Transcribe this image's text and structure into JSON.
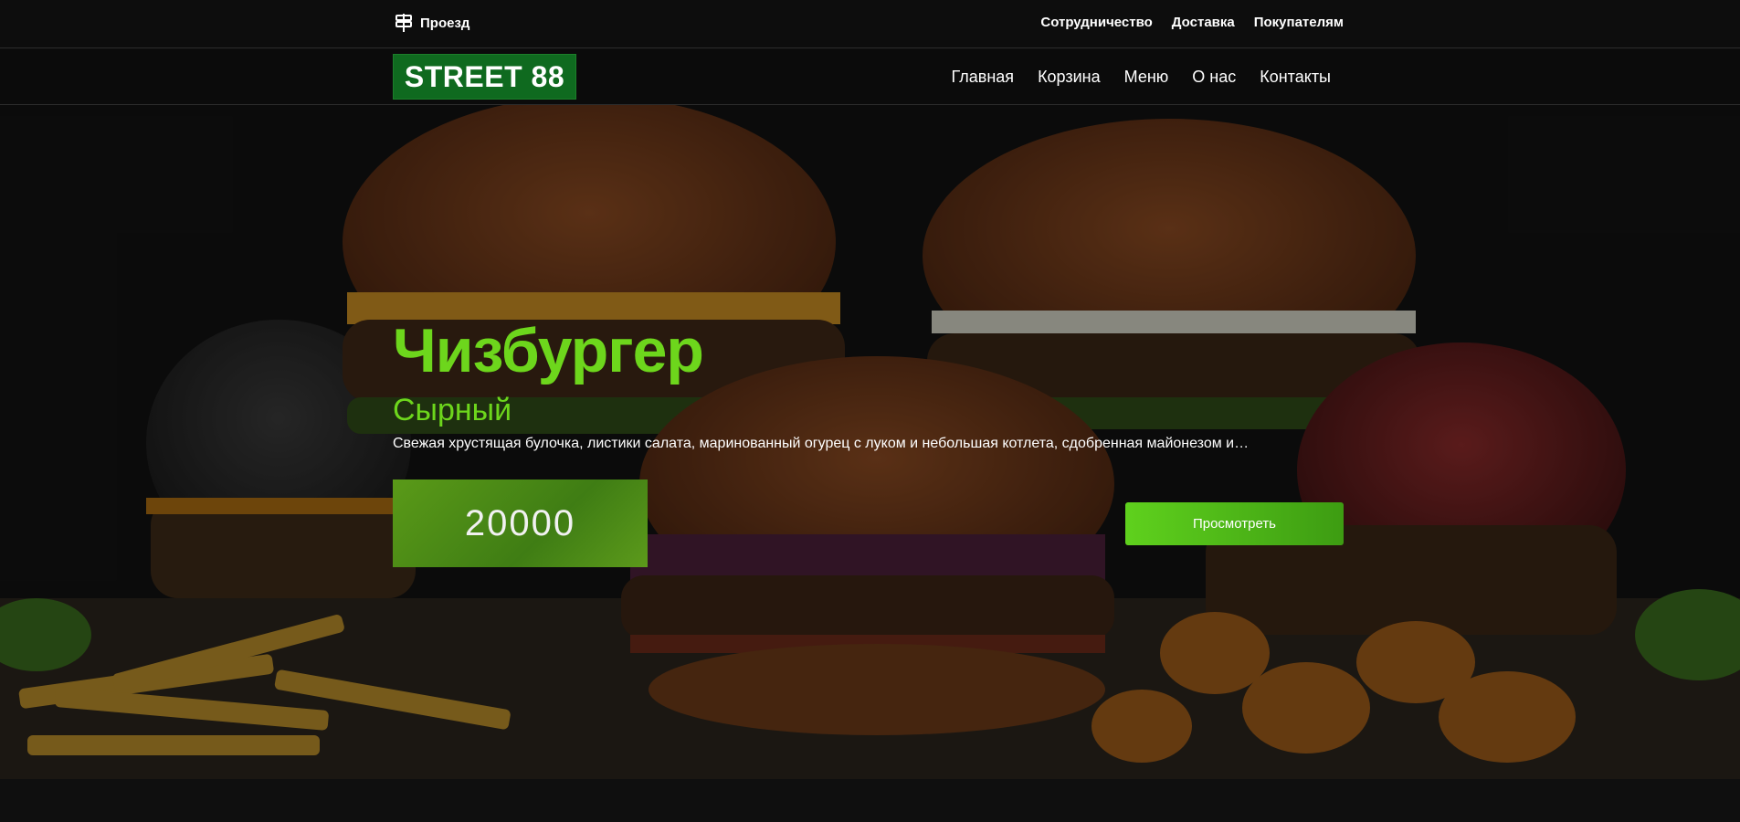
{
  "topbar": {
    "directions_label": "Проезд",
    "links": [
      "Сотрудничество",
      "Доставка",
      "Покупателям"
    ]
  },
  "navbar": {
    "logo": "STREET 88",
    "links": [
      "Главная",
      "Корзина",
      "Меню",
      "О нас",
      "Контакты"
    ]
  },
  "hero": {
    "title": "Чизбургер",
    "subtitle": "Сырный",
    "description": "Свежая хрустящая булочка, листики салата, маринованный огурец с луком и небольшая котлета, сдобренная майонезом и…",
    "price": "20000",
    "view_button": "Просмотреть"
  },
  "colors": {
    "accent": "#6dd61c",
    "logo_bg": "#0f6a1f",
    "page_bg": "#0d0d0d"
  },
  "icons": {
    "directions": "signpost-icon"
  }
}
